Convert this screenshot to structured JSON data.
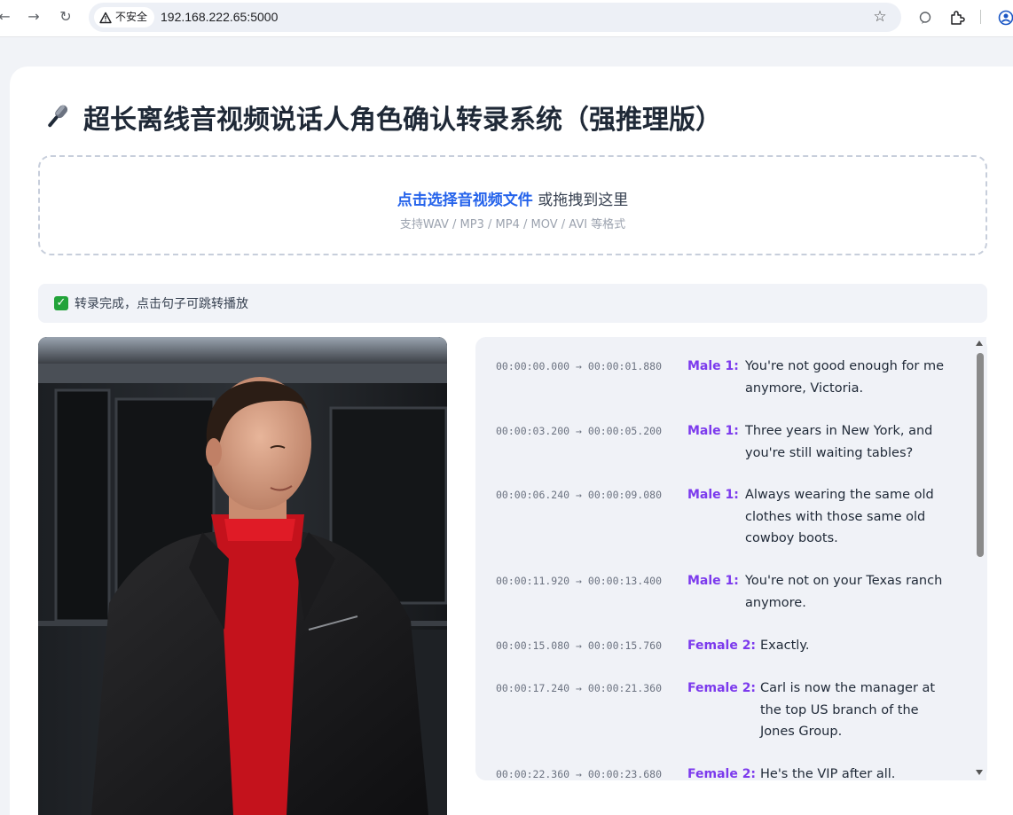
{
  "browser": {
    "back_icon": "arrow-left-icon",
    "forward_icon": "arrow-right-icon",
    "reload_icon": "reload-icon",
    "security_label": "不安全",
    "url": "192.168.222.65:5000",
    "bookmark_icon": "star-icon",
    "extension_icons": [
      "chat-icon",
      "puzzle-icon",
      "profile-icon"
    ]
  },
  "page": {
    "title": "超长离线音视频说话人角色确认转录系统（强推理版）",
    "title_icon": "microphone-icon",
    "upload": {
      "link_text": "点击选择音视频文件",
      "rest_text": " 或拖拽到这里",
      "formats_text": "支持WAV / MP3 / MP4 / MOV / AVI 等格式"
    },
    "status": {
      "icon": "check-mark-icon",
      "text": "转录完成，点击句子可跳转播放"
    }
  },
  "transcript": {
    "segments": [
      {
        "start": "00:00:00.000",
        "end": "00:00:01.880",
        "speaker": "Male 1:",
        "text": "You're not good enough for me anymore, Victoria."
      },
      {
        "start": "00:00:03.200",
        "end": "00:00:05.200",
        "speaker": "Male 1:",
        "text": "Three years in New York, and you're still waiting tables?"
      },
      {
        "start": "00:00:06.240",
        "end": "00:00:09.080",
        "speaker": "Male 1:",
        "text": "Always wearing the same old clothes with those same old cowboy boots."
      },
      {
        "start": "00:00:11.920",
        "end": "00:00:13.400",
        "speaker": "Male 1:",
        "text": "You're not on your Texas ranch anymore."
      },
      {
        "start": "00:00:15.080",
        "end": "00:00:15.760",
        "speaker": "Female 2:",
        "text": "Exactly."
      },
      {
        "start": "00:00:17.240",
        "end": "00:00:21.360",
        "speaker": "Female 2:",
        "text": "Carl is now the manager at the top US branch of the Jones Group."
      },
      {
        "start": "00:00:22.360",
        "end": "00:00:23.680",
        "speaker": "Female 2:",
        "text": "He's the VIP after all."
      }
    ],
    "arrow": "→"
  }
}
